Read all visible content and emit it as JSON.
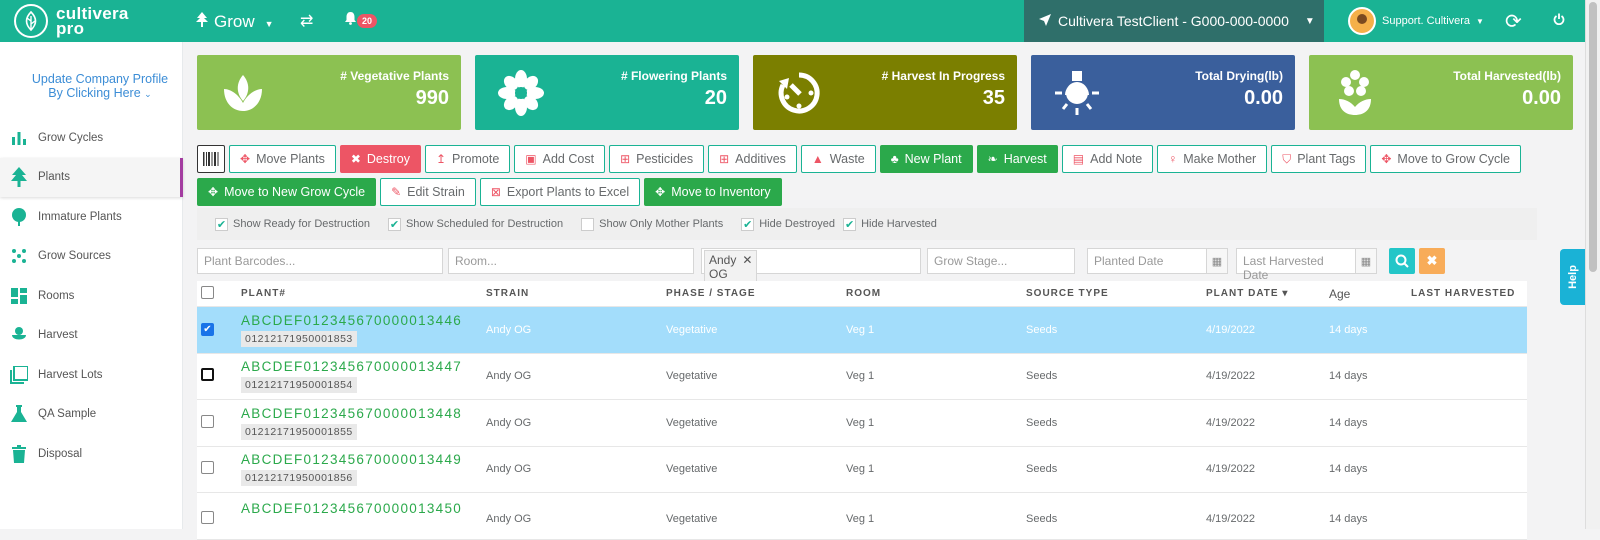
{
  "app": {
    "logo_line1": "cultivera",
    "logo_line2": "pro"
  },
  "topbar": {
    "grow_label": "Grow",
    "notification_count": "20",
    "client": "Cultivera TestClient - G000-000-0000",
    "user": "Support. Cultivera"
  },
  "sidebar": {
    "profile_line1": "Update Company Profile",
    "profile_line2": "By Clicking Here",
    "items": [
      {
        "label": "Grow Cycles",
        "icon": "bar-chart-icon"
      },
      {
        "label": "Plants",
        "icon": "tree-icon"
      },
      {
        "label": "Immature Plants",
        "icon": "sapling-icon"
      },
      {
        "label": "Grow Sources",
        "icon": "seeds-icon"
      },
      {
        "label": "Rooms",
        "icon": "rooms-icon"
      },
      {
        "label": "Harvest",
        "icon": "harvest-icon"
      },
      {
        "label": "Harvest Lots",
        "icon": "lots-icon"
      },
      {
        "label": "QA Sample",
        "icon": "flask-icon"
      },
      {
        "label": "Disposal",
        "icon": "trash-icon"
      }
    ]
  },
  "cards": [
    {
      "label": "# Vegetative Plants",
      "value": "990",
      "color": "#8cc152"
    },
    {
      "label": "# Flowering Plants",
      "value": "20",
      "color": "#1ab394"
    },
    {
      "label": "# Harvest In Progress",
      "value": "35",
      "color": "#7b7f00"
    },
    {
      "label": "Total Drying(lb)",
      "value": "0.00",
      "color": "#3a5f9c"
    },
    {
      "label": "Total Harvested(lb)",
      "value": "0.00",
      "color": "#8cc152"
    }
  ],
  "actions": {
    "move_plants": "Move Plants",
    "destroy": "Destroy",
    "promote": "Promote",
    "add_cost": "Add Cost",
    "pesticides": "Pesticides",
    "additives": "Additives",
    "waste": "Waste",
    "new_plant": "New Plant",
    "harvest": "Harvest",
    "add_note": "Add Note",
    "make_mother": "Make Mother",
    "plant_tags": "Plant Tags",
    "move_to_grow_cycle": "Move to Grow Cycle",
    "move_to_new_grow_cycle": "Move to New Grow Cycle",
    "edit_strain": "Edit Strain",
    "export_excel": "Export Plants to Excel",
    "move_to_inventory": "Move to Inventory"
  },
  "filters": {
    "ready_for_destruction": {
      "label": "Show Ready for Destruction",
      "checked": true
    },
    "scheduled_for_destruction": {
      "label": "Show Scheduled for Destruction",
      "checked": true
    },
    "only_mother": {
      "label": "Show Only Mother Plants",
      "checked": false
    },
    "hide_destroyed": {
      "label": "Hide Destroyed",
      "checked": true
    },
    "hide_harvested": {
      "label": "Hide Harvested",
      "checked": true
    }
  },
  "search": {
    "barcodes_placeholder": "Plant Barcodes...",
    "room_placeholder": "Room...",
    "strain_chip": "Andy OG",
    "stage_placeholder": "Grow Stage...",
    "planted_placeholder": "Planted Date",
    "harvested_placeholder": "Last Harvested Date"
  },
  "table": {
    "headers": {
      "plant": "PLANT#",
      "strain": "STRAIN",
      "phase": "PHASE / STAGE",
      "room": "ROOM",
      "source": "SOURCE TYPE",
      "plant_date": "PLANT DATE ▾",
      "age": "Age",
      "last_harvested": "LAST HARVESTED"
    },
    "rows": [
      {
        "plant": "ABCDEF012345670000013446",
        "tag": "01212171950001853",
        "strain": "Andy OG",
        "phase": "Vegetative",
        "room": "Veg 1",
        "source": "Seeds",
        "date": "4/19/2022",
        "age": "14 days"
      },
      {
        "plant": "ABCDEF012345670000013447",
        "tag": "01212171950001854",
        "strain": "Andy OG",
        "phase": "Vegetative",
        "room": "Veg 1",
        "source": "Seeds",
        "date": "4/19/2022",
        "age": "14 days"
      },
      {
        "plant": "ABCDEF012345670000013448",
        "tag": "01212171950001855",
        "strain": "Andy OG",
        "phase": "Vegetative",
        "room": "Veg 1",
        "source": "Seeds",
        "date": "4/19/2022",
        "age": "14 days"
      },
      {
        "plant": "ABCDEF012345670000013449",
        "tag": "01212171950001856",
        "strain": "Andy OG",
        "phase": "Vegetative",
        "room": "Veg 1",
        "source": "Seeds",
        "date": "4/19/2022",
        "age": "14 days"
      },
      {
        "plant": "ABCDEF012345670000013450",
        "tag": "",
        "strain": "Andy OG",
        "phase": "Vegetative",
        "room": "Veg 1",
        "source": "Seeds",
        "date": "4/19/2022",
        "age": "14 days"
      }
    ]
  },
  "help_label": "Help"
}
